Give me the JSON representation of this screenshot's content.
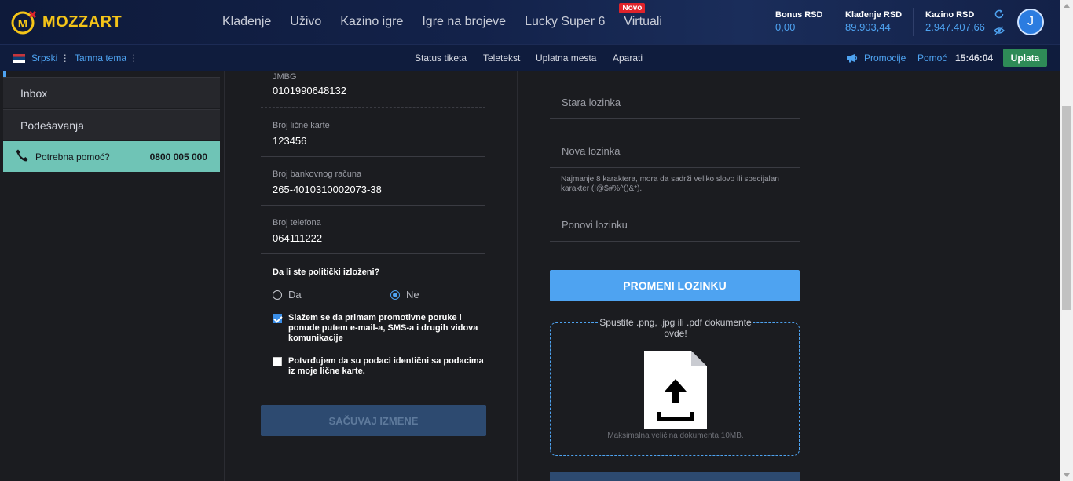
{
  "brand": {
    "name": "MOZZART"
  },
  "nav": {
    "items": [
      "Klađenje",
      "Uživo",
      "Kazino igre",
      "Igre na brojeve",
      "Lucky Super 6",
      "Virtuali"
    ],
    "new_badge": "Novo"
  },
  "balances": [
    {
      "label": "Bonus RSD",
      "value": "0,00"
    },
    {
      "label": "Klađenje RSD",
      "value": "89.903,44"
    },
    {
      "label": "Kazino RSD",
      "value": "2.947.407,66"
    }
  ],
  "user": {
    "initial": "J"
  },
  "subnav": {
    "language": "Srpski",
    "theme": "Tamna tema",
    "links": [
      "Status tiketa",
      "Teletekst",
      "Uplatna mesta",
      "Aparati"
    ],
    "promotions": "Promocije",
    "help": "Pomoć",
    "time": "15:46:04",
    "deposit": "Uplata"
  },
  "sidebar": {
    "items": [
      "Inbox",
      "Podešavanja"
    ],
    "help_label": "Potrebna pomoć?",
    "help_phone": "0800 005 000"
  },
  "profile": {
    "fields": [
      {
        "label": "JMBG",
        "value": "0101990648132"
      },
      {
        "label": "Broj lične karte",
        "value": "123456"
      },
      {
        "label": "Broj bankovnog računa",
        "value": "265-4010310002073-38"
      },
      {
        "label": "Broj telefona",
        "value": "064111222"
      }
    ],
    "politics_question": "Da li ste politički izloženi?",
    "politics_options": [
      "Da",
      "Ne"
    ],
    "politics_selected": "Ne",
    "consent_promo": "Slažem se da primam promotivne poruke i ponude putem e-mail-a, SMS-a i drugih vidova komunikacije",
    "consent_promo_checked": true,
    "consent_data": "Potvrđujem da su podaci identični sa podacima iz moje lične karte.",
    "consent_data_checked": false,
    "save_label": "SAČUVAJ IZMENE"
  },
  "password": {
    "old_placeholder": "Stara lozinka",
    "new_placeholder": "Nova lozinka",
    "hint": "Najmanje 8 karaktera, mora da sadrži veliko slovo ili specijalan karakter (!@$#%^()&*).",
    "repeat_placeholder": "Ponovi lozinku",
    "change_label": "PROMENI LOZINKU"
  },
  "upload": {
    "title": "Spustite .png, .jpg ili .pdf dokumente ovde!",
    "max_size": "Maksimalna veličina dokumenta 10MB.",
    "icon": "upload-document-icon"
  },
  "colors": {
    "accent": "#4ea3f1",
    "brand_yellow": "#f5c518",
    "deposit_green": "#2e8b57",
    "help_teal": "#6fc4b6"
  }
}
